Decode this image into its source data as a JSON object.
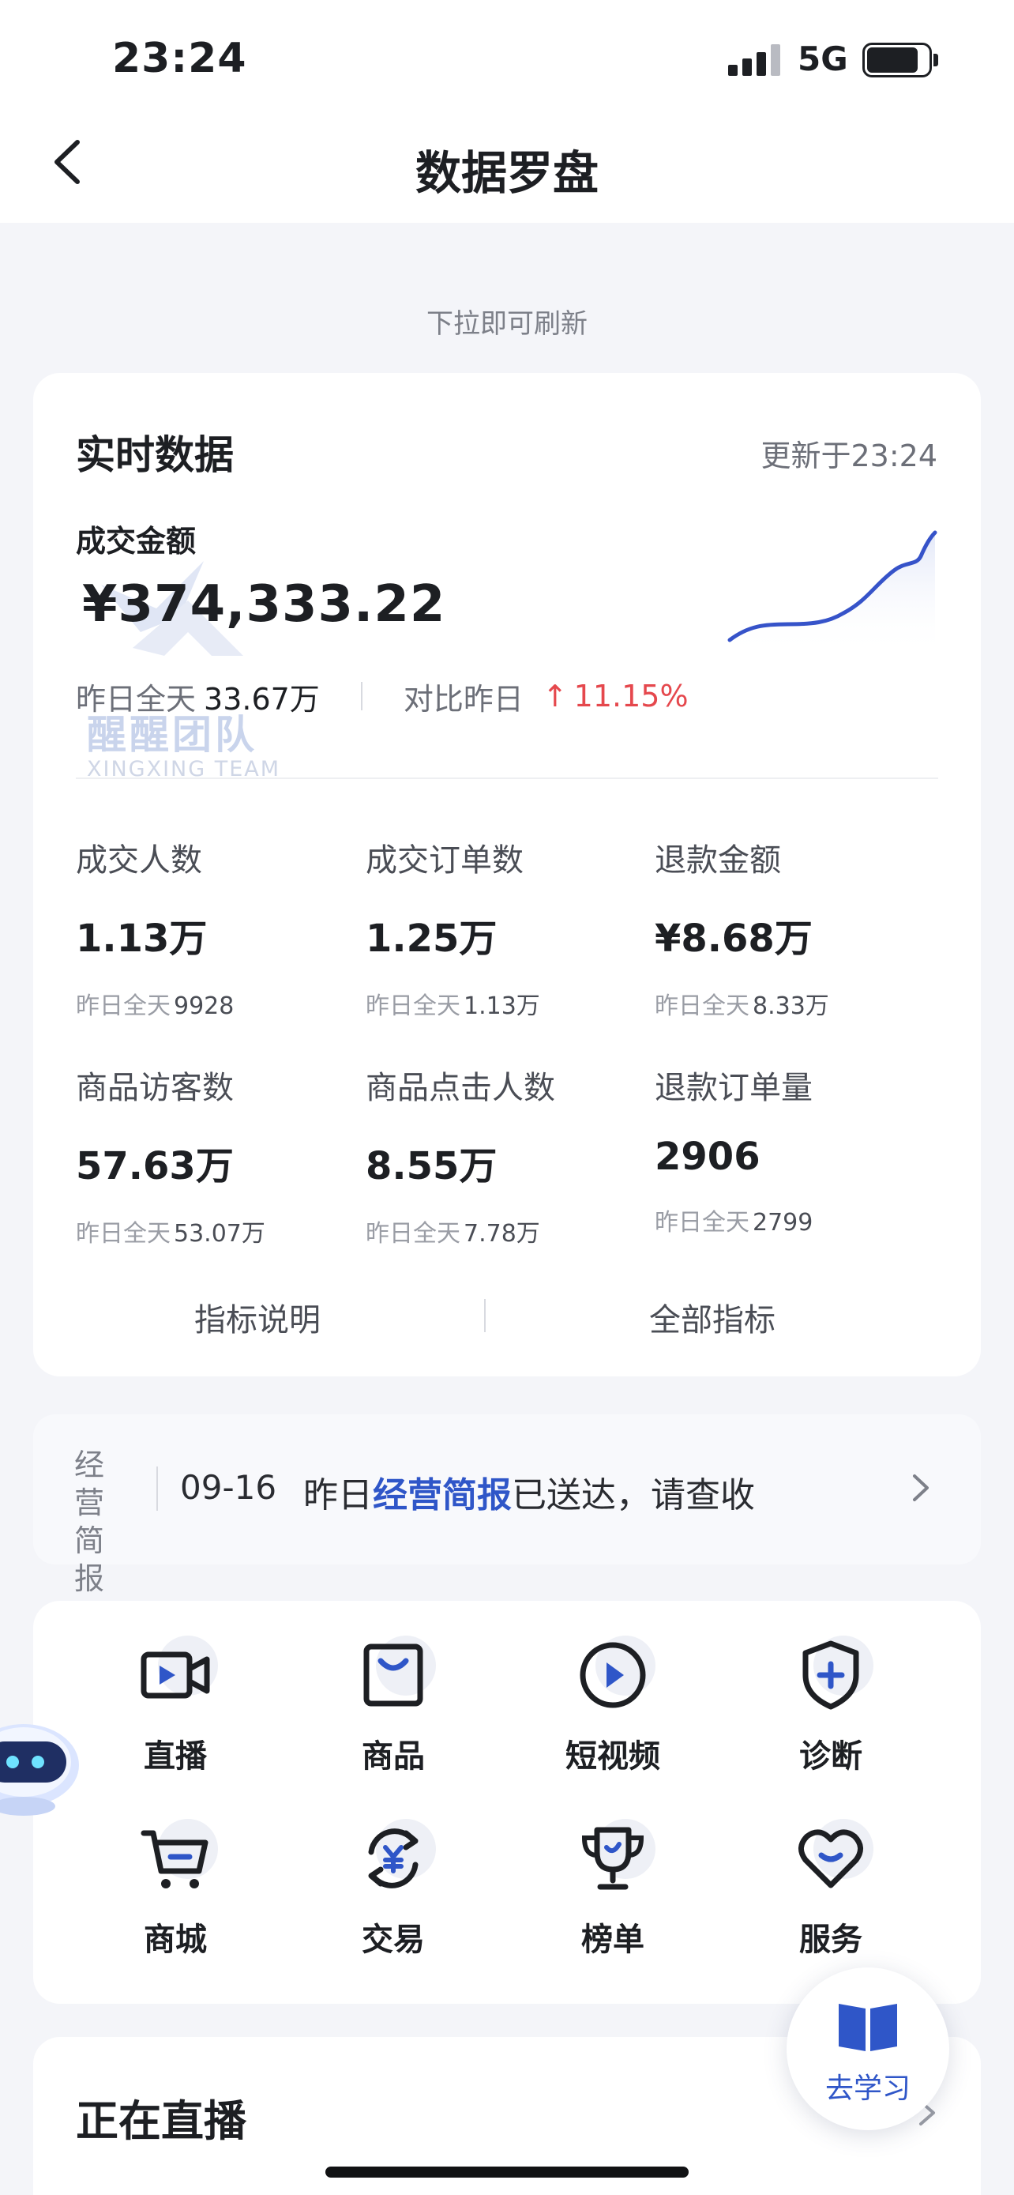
{
  "status_bar": {
    "time": "23:24",
    "network": "5G"
  },
  "header": {
    "title": "数据罗盘"
  },
  "refresh_hint": "下拉即可刷新",
  "realtime": {
    "title": "实时数据",
    "updated": "更新于23:24",
    "gmv_label": "成交金额",
    "gmv_value": "¥374,333.22",
    "yesterday_label": "昨日全天",
    "yesterday_value": "33.67万",
    "compare_label": "对比昨日",
    "compare_pct": "11.15%",
    "metrics": [
      {
        "label": "成交人数",
        "value": "1.13万",
        "yday_label": "昨日全天",
        "yday_value": "9928"
      },
      {
        "label": "成交订单数",
        "value": "1.25万",
        "yday_label": "昨日全天",
        "yday_value": "1.13万"
      },
      {
        "label": "退款金额",
        "value": "¥8.68万",
        "yday_label": "昨日全天",
        "yday_value": "8.33万"
      },
      {
        "label": "商品访客数",
        "value": "57.63万",
        "yday_label": "昨日全天",
        "yday_value": "53.07万"
      },
      {
        "label": "商品点击人数",
        "value": "8.55万",
        "yday_label": "昨日全天",
        "yday_value": "7.78万"
      },
      {
        "label": "退款订单量",
        "value": "2906",
        "yday_label": "昨日全天",
        "yday_value": "2799"
      }
    ],
    "links": {
      "explain": "指标说明",
      "all": "全部指标"
    }
  },
  "watermark": {
    "cn": "醒醒团队",
    "en": "XINGXING TEAM"
  },
  "brief": {
    "vertical": [
      "经",
      "营",
      "简",
      "报"
    ],
    "date": "09-16",
    "text_pre": "昨日",
    "text_link": "经营简报",
    "text_post": "已送达，请查收"
  },
  "shortcuts": [
    {
      "label": "直播",
      "icon": "live-camera-icon"
    },
    {
      "label": "商品",
      "icon": "product-bag-icon"
    },
    {
      "label": "短视频",
      "icon": "play-circle-icon"
    },
    {
      "label": "诊断",
      "icon": "shield-plus-icon"
    },
    {
      "label": "商城",
      "icon": "cart-icon"
    },
    {
      "label": "交易",
      "icon": "yuan-exchange-icon"
    },
    {
      "label": "榜单",
      "icon": "trophy-icon"
    },
    {
      "label": "服务",
      "icon": "heart-service-icon"
    }
  ],
  "live": {
    "title": "正在直播"
  },
  "learn": {
    "label": "去学习"
  },
  "colors": {
    "accent": "#2f56c8",
    "up": "#e5484d",
    "background": "#f4f5f9"
  }
}
